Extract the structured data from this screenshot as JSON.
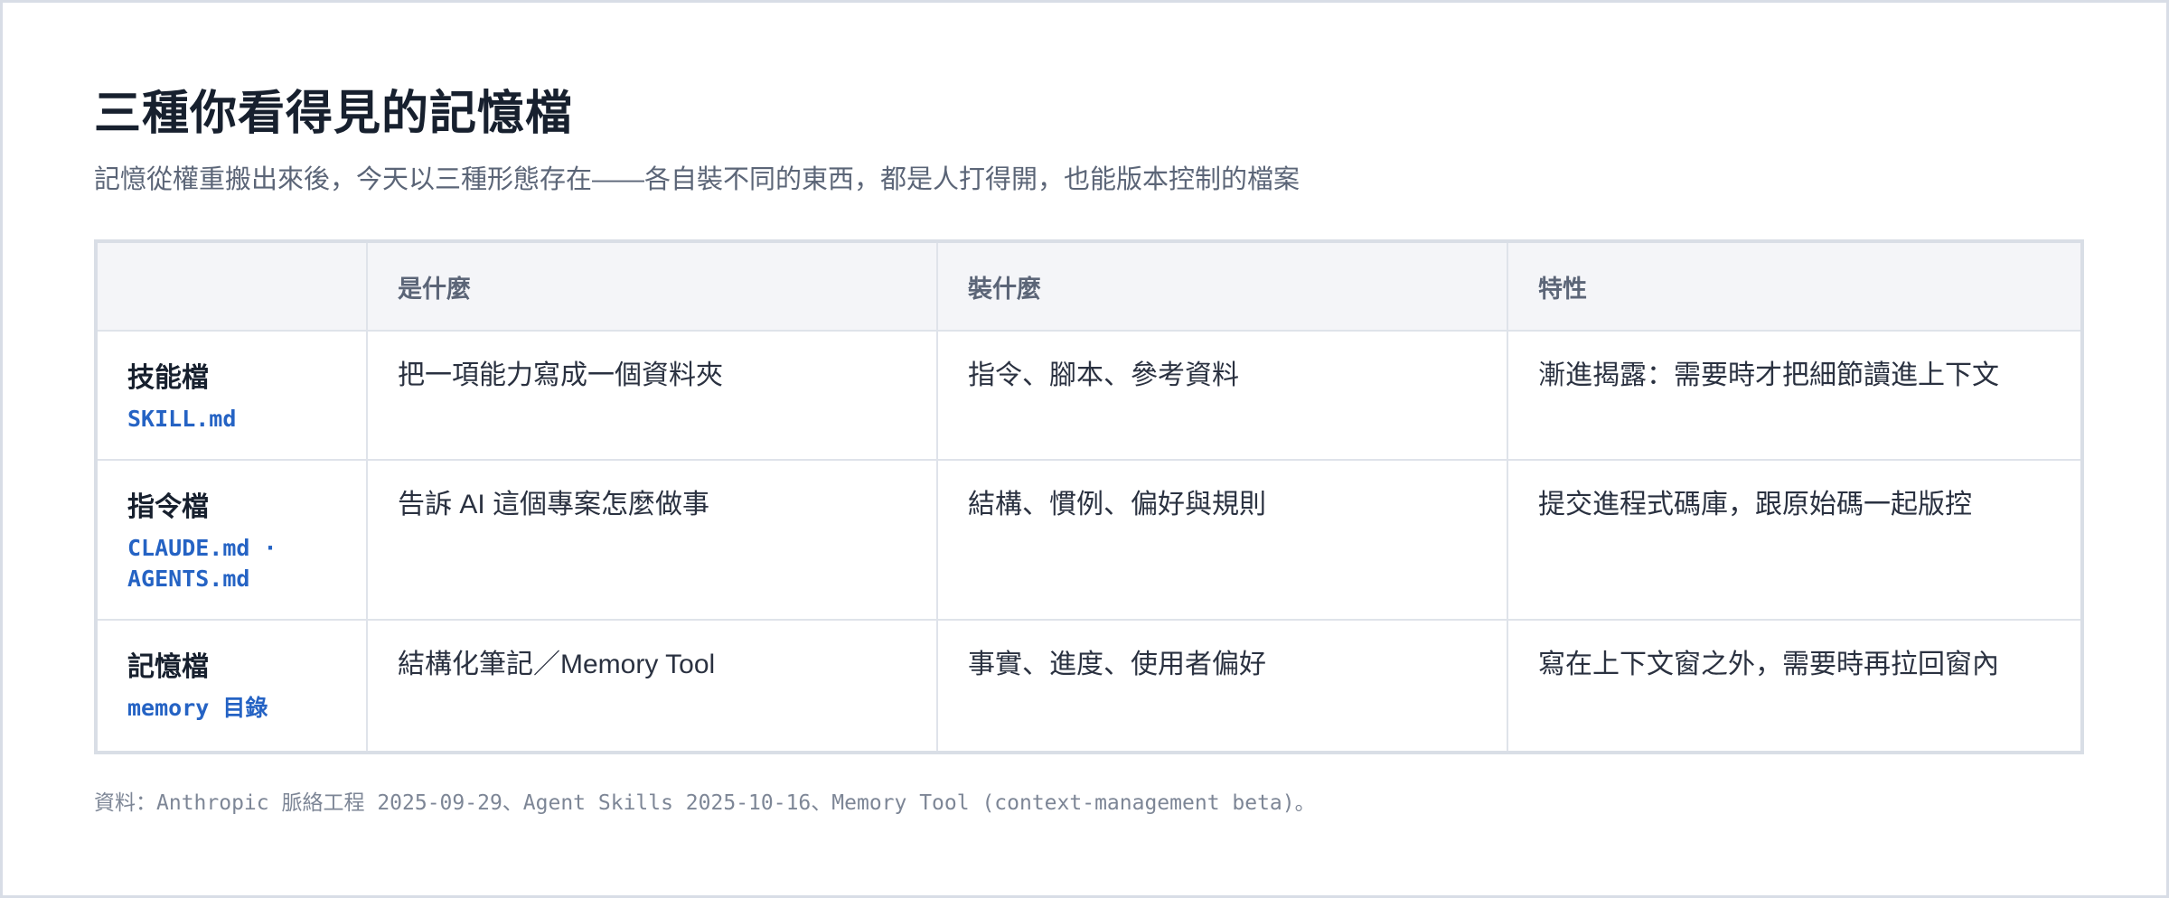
{
  "page": {
    "title": "三種你看得見的記憶檔",
    "subtitle": "記憶從權重搬出來後，今天以三種形態存在——各自裝不同的東西，都是人打得開，也能版本控制的檔案"
  },
  "table": {
    "headers": [
      "",
      "是什麼",
      "裝什麼",
      "特性"
    ],
    "rows": [
      {
        "name": "技能檔",
        "code": "SKILL.md",
        "what": "把一項能力寫成一個資料夾",
        "contains": "指令、腳本、參考資料",
        "trait": "漸進揭露：需要時才把細節讀進上下文"
      },
      {
        "name": "指令檔",
        "code": "CLAUDE.md · AGENTS.md",
        "what": "告訴 AI 這個專案怎麼做事",
        "contains": "結構、慣例、偏好與規則",
        "trait": "提交進程式碼庫，跟原始碼一起版控"
      },
      {
        "name": "記憶檔",
        "code": "memory 目錄",
        "what": "結構化筆記／Memory Tool",
        "contains": "事實、進度、使用者偏好",
        "trait": "寫在上下文窗之外，需要時再拉回窗內"
      }
    ]
  },
  "footer": {
    "source": "資料：Anthropic 脈絡工程 2025-09-29、Agent Skills 2025-10-16、Memory Tool (context-management beta)。"
  },
  "colors": {
    "accent_code": "#2563c4",
    "header_bg": "#f4f5f8",
    "border": "#dfe3ea"
  }
}
